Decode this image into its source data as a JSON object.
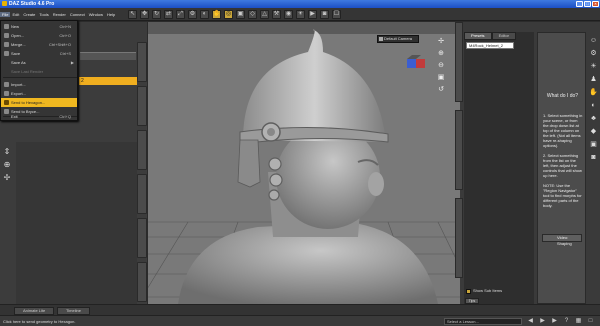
{
  "window": {
    "title": "DAZ Studio 4.6 Pro",
    "controls": [
      "_",
      "□",
      "×"
    ]
  },
  "menubar": {
    "items": [
      "File",
      "Edit",
      "Create",
      "Tools",
      "Render",
      "Connect",
      "Window",
      "Help"
    ]
  },
  "file_menu": {
    "items": [
      {
        "label": "New",
        "shortcut": "Ctrl+N",
        "state": "normal"
      },
      {
        "label": "Open...",
        "shortcut": "Ctrl+O",
        "state": "normal"
      },
      {
        "label": "Merge...",
        "shortcut": "Ctrl+Shift+O",
        "state": "normal"
      },
      {
        "label": "Save",
        "shortcut": "Ctrl+S",
        "state": "normal"
      },
      {
        "label": "Save As",
        "shortcut": "",
        "submenu": true,
        "state": "normal"
      },
      {
        "label": "Save Last Render",
        "shortcut": "",
        "state": "disabled"
      },
      {
        "label": "Import...",
        "shortcut": "",
        "state": "normal"
      },
      {
        "label": "Export...",
        "shortcut": "",
        "state": "normal"
      },
      {
        "label": "Send to Hexagon...",
        "shortcut": "",
        "state": "highlighted"
      },
      {
        "label": "Send to Bryce...",
        "shortcut": "",
        "state": "normal"
      },
      {
        "label": "Exit",
        "shortcut": "Ctrl+Q",
        "state": "normal"
      }
    ]
  },
  "viewport": {
    "camera_label": "Default Camera"
  },
  "right_panel": {
    "tabs": [
      "Presets",
      "Editor"
    ],
    "selected_item": "M4Rock_Helmet_2",
    "checkbox_label": "Show Sub Items",
    "tips_label": "Tips"
  },
  "help": {
    "title": "What do I do?",
    "step1": "1. Select something in your scene, or from the drop down list at top of the column on the left. (Not all items have re-shaping options).",
    "step2": "2. Select something from the list on the left, then adjust the controls that will show up here.",
    "note": "NOTE: Use the \"Region Navigator\" tool to find morphs for different parts of the body.",
    "button_label": "Video: Shaping"
  },
  "bottom_tabs": [
    "Animate Lite",
    "Timeline"
  ],
  "status": {
    "text": "Click here to send geometry to Hexagon.",
    "lesson_placeholder": "Select a Lesson..."
  },
  "colors": {
    "highlight": "#f0b820",
    "title_bar": "#2a62d4"
  }
}
